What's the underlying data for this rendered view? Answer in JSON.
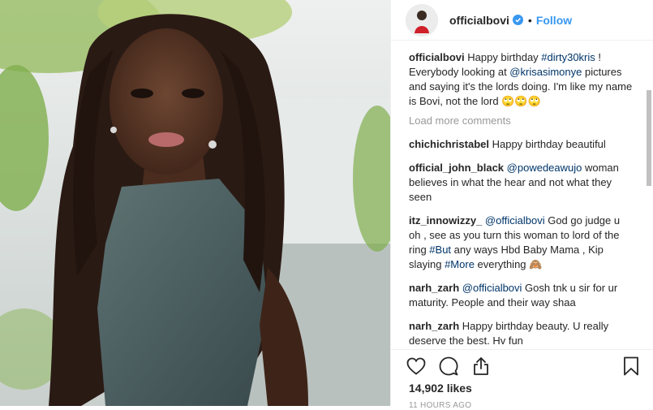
{
  "post": {
    "username": "officialbovi",
    "separator": "•",
    "follow_label": "Follow"
  },
  "caption": {
    "username": "officialbovi",
    "text_1": " Happy birthday ",
    "tag_1": "#dirty30kris",
    "text_2": " ! Everybody looking at ",
    "mention_1": "@krisasimonye",
    "text_3": " pictures and saying it's the lords doing. I'm like my name is Bovi, not the lord 🙄🙄🙄"
  },
  "load_more_label": "Load more comments",
  "comments": [
    {
      "username": "chichichristabel",
      "text": " Happy birthday beautiful"
    },
    {
      "username": "official_john_black",
      "mention": "@powedeawujo",
      "text": " woman believes in what the hear and not what they seen"
    },
    {
      "username": "itz_innowizzy_",
      "mention": "@officialbovi",
      "text_1": " God go judge u oh , see as you turn this woman to lord of the ring ",
      "tag_1": "#But",
      "text_2": " any ways Hbd Baby Mama , Kip slaying ",
      "tag_2": "#More",
      "text_3": " everything 🙈"
    },
    {
      "username": "narh_zarh",
      "mention": "@officialbovi",
      "text": " Gosh tnk u sir for ur maturity. People and their way shaa"
    },
    {
      "username": "narh_zarh",
      "text": " Happy birthday beauty. U really deserve the best. Hv fun"
    }
  ],
  "likes_label": "14,902 likes",
  "timestamp": "11 HOURS AGO",
  "colors": {
    "accent": "#3897f0",
    "link": "#003569",
    "muted": "#999999"
  },
  "icons": {
    "like": "heart-icon",
    "comment": "comment-icon",
    "share": "share-icon",
    "save": "bookmark-icon",
    "verified": "verified-badge-icon"
  }
}
